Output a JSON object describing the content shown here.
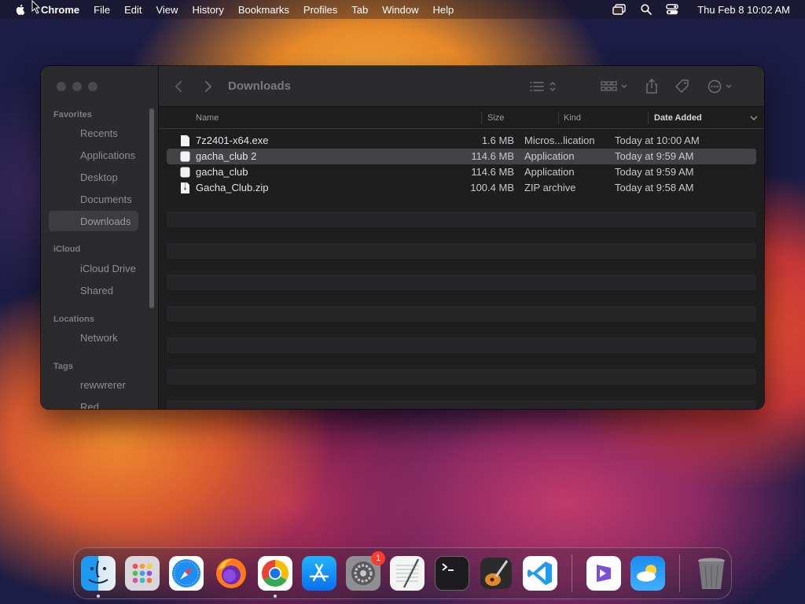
{
  "menubar": {
    "app": "Chrome",
    "items": [
      "File",
      "Edit",
      "View",
      "History",
      "Bookmarks",
      "Profiles",
      "Tab",
      "Window",
      "Help"
    ],
    "clock": "Thu Feb 8  10:02 AM"
  },
  "finder": {
    "title": "Downloads",
    "sidebar": {
      "favorites_label": "Favorites",
      "favorites": [
        "Recents",
        "Applications",
        "Desktop",
        "Documents",
        "Downloads"
      ],
      "icloud_label": "iCloud",
      "icloud": [
        "iCloud Drive",
        "Shared"
      ],
      "locations_label": "Locations",
      "locations": [
        "Network"
      ],
      "tags_label": "Tags",
      "tags": [
        "rewwrerer",
        "Red"
      ]
    },
    "columns": {
      "name": "Name",
      "size": "Size",
      "kind": "Kind",
      "date": "Date Added"
    },
    "files": [
      {
        "name": "7z2401-x64.exe",
        "size": "1.6 MB",
        "kind": "Micros...lication",
        "date": "Today at 10:00 AM",
        "selected": false
      },
      {
        "name": "gacha_club 2",
        "size": "114.6 MB",
        "kind": "Application",
        "date": "Today at 9:59 AM",
        "selected": true
      },
      {
        "name": "gacha_club",
        "size": "114.6 MB",
        "kind": "Application",
        "date": "Today at 9:59 AM",
        "selected": false
      },
      {
        "name": "Gacha_Club.zip",
        "size": "100.4 MB",
        "kind": "ZIP archive",
        "date": "Today at 9:58 AM",
        "selected": false
      }
    ]
  },
  "dock": {
    "apps": [
      "finder-icon",
      "launchpad-icon",
      "safari-icon",
      "firefox-icon",
      "chrome-icon",
      "app-store-icon",
      "system-settings-icon",
      "textedit-icon",
      "terminal-icon",
      "garageband-icon",
      "vscode-icon",
      "visual-studio-icon",
      "weather-icon",
      "trash-icon"
    ],
    "settings_badge": "1"
  }
}
